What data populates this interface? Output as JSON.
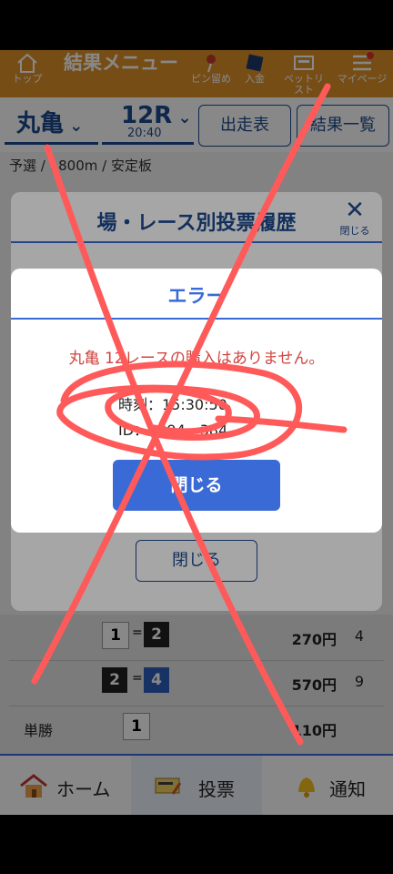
{
  "header": {
    "home_label": "トップ",
    "title": "結果メニュー",
    "pin_label": "ピン留め",
    "deposit_label": "入金",
    "betlist_label": "ベットリスト",
    "mypage_label": "マイページ"
  },
  "venue_bar": {
    "venue": "丸亀",
    "race": "12R",
    "race_time": "20:40",
    "entry_button": "出走表",
    "results_button": "結果一覧",
    "subinfo": "予選 / 1800m / 安定板"
  },
  "history_modal": {
    "title": "場・レース別投票履歴",
    "close_label": "閉じる",
    "close_button": "閉じる"
  },
  "results_table": {
    "rows": [
      {
        "label": "",
        "num1": "1",
        "num2": "2",
        "amount": "270円",
        "popularity": "4"
      },
      {
        "label": "",
        "num1": "2",
        "num2": "4",
        "amount": "570円",
        "popularity": "9"
      },
      {
        "label": "単勝",
        "num1": "1",
        "num2": "",
        "amount": "110円",
        "popularity": ""
      }
    ]
  },
  "error_dialog": {
    "title": "エラー",
    "message": "丸亀 12レースの購入はありません。",
    "time_line": "時刻：15:30:50",
    "id_line": "ID：1294 - 384",
    "close_button": "閉じる"
  },
  "footer_nav": {
    "home": "ホーム",
    "vote": "投票",
    "notify": "通知"
  },
  "colors": {
    "brand_orange": "#e0922a",
    "navy": "#1e4a8f",
    "accent_blue": "#3a6ad6",
    "error_red": "#d0453f",
    "scribble": "#ff5a5a"
  }
}
